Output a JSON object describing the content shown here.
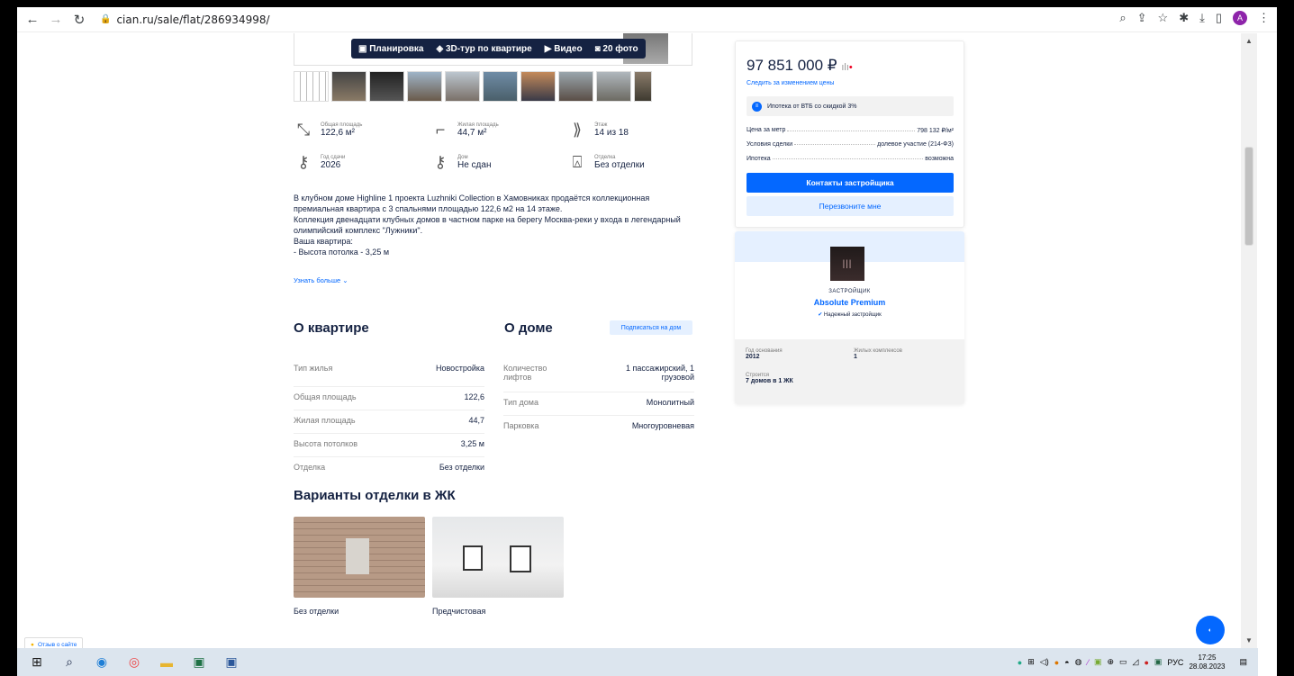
{
  "browser": {
    "url": "cian.ru/sale/flat/286934998/",
    "avatar_letter": "A"
  },
  "media_bar": {
    "plan": "Планировка",
    "tour": "3D-тур по квартире",
    "video": "Видео",
    "photos": "20 фото"
  },
  "features": {
    "total_area_label": "Общая площадь",
    "total_area": "122,6 м²",
    "living_area_label": "Жилая площадь",
    "living_area": "44,7 м²",
    "floor_label": "Этаж",
    "floor": "14 из 18",
    "year_label": "Год сдачи",
    "year": "2026",
    "house_label": "Дом",
    "house": "Не сдан",
    "finish_label": "Отделка",
    "finish": "Без отделки"
  },
  "description": {
    "line1": "В клубном доме Highline 1 проекта Luzhniki Collection в Хамовниках продаётся коллекционная",
    "line2": "премиальная квартира с 3 спальнями площадью 122,6 м2 на 14 этаже.",
    "line3": "Коллекция двенадцати клубных домов в частном парке на берегу Москва-реки у входа в легендарный",
    "line4": "олимпийский комплекс \"Лужники\".",
    "line5": "Ваша квартира:",
    "line6": "- Высота потолка - 3,25 м",
    "more": "Узнать больше"
  },
  "about_flat": {
    "title": "О квартире",
    "rows": [
      {
        "k": "Тип жилья",
        "v": "Новостройка"
      },
      {
        "k": "Общая площадь",
        "v": "122,6"
      },
      {
        "k": "Жилая площадь",
        "v": "44,7"
      },
      {
        "k": "Высота потолков",
        "v": "3,25 м"
      },
      {
        "k": "Отделка",
        "v": "Без отделки"
      }
    ]
  },
  "about_house": {
    "title": "О доме",
    "subscribe": "Подписаться на дом",
    "rows": [
      {
        "k": "Количество лифтов",
        "v": "1 пассажирский, 1 грузовой"
      },
      {
        "k": "Тип дома",
        "v": "Монолитный"
      },
      {
        "k": "Парковка",
        "v": "Многоуровневая"
      }
    ]
  },
  "finishing": {
    "title": "Варианты отделки в ЖК",
    "items": [
      "Без отделки",
      "Предчистовая"
    ]
  },
  "price_card": {
    "price": "97 851 000 ₽",
    "follow": "Следить за изменением цены",
    "mortgage_offer": "Ипотека от ВТБ со скидкой 3%",
    "price_per_m_label": "Цена за метр",
    "price_per_m": "798 132 ₽/м²",
    "deal_label": "Условия сделки",
    "deal": "долевое участие (214-ФЗ)",
    "mortgage_label": "Ипотека",
    "mortgage": "возможна",
    "contacts_button": "Контакты застройщика",
    "callback_button": "Перезвоните мне"
  },
  "developer": {
    "role": "ЗАСТРОЙЩИК",
    "name": "Absolute Premium",
    "reliable": "Надежный застройщик",
    "founded_label": "Год основания",
    "founded": "2012",
    "complexes_label": "Жилых комплексов",
    "complexes": "1",
    "building_label": "Строится",
    "building": "7 домов в 1 ЖК"
  },
  "feedback": "Отзыв о сайте",
  "taskbar": {
    "lang": "РУС",
    "time": "17:25",
    "date": "28.08.2023"
  }
}
